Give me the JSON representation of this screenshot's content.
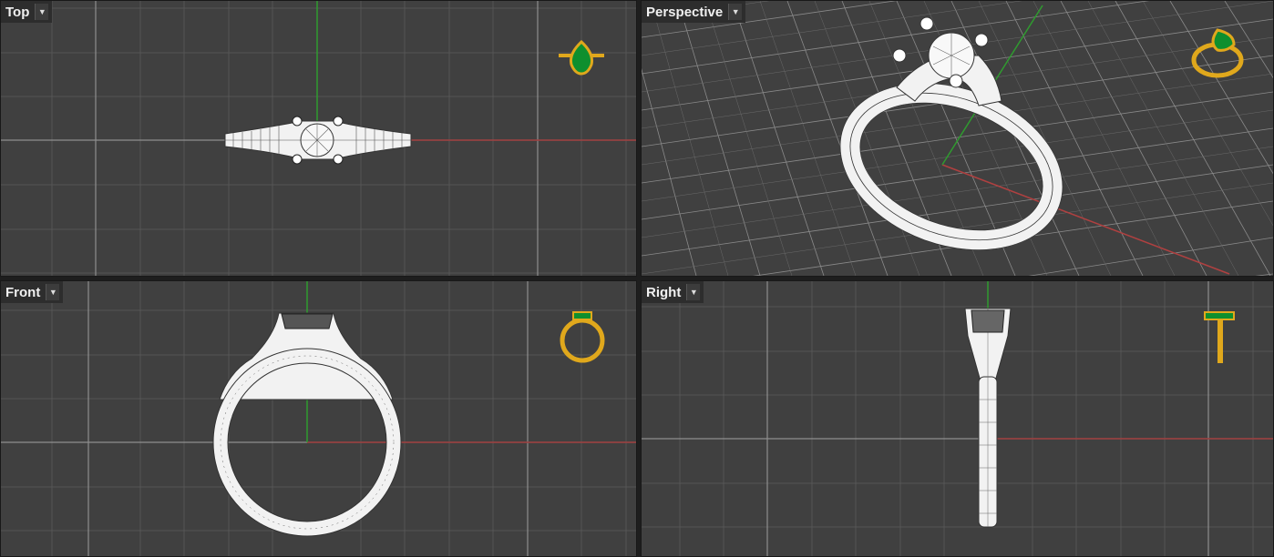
{
  "viewports": {
    "top": {
      "label": "Top",
      "menu_icon": "chevron-down-icon"
    },
    "perspective": {
      "label": "Perspective",
      "menu_icon": "chevron-down-icon"
    },
    "front": {
      "label": "Front",
      "menu_icon": "chevron-down-icon"
    },
    "right": {
      "label": "Right",
      "menu_icon": "chevron-down-icon"
    }
  },
  "colors": {
    "viewport_bg": "#404040",
    "grid_minor": "#4e4e4e",
    "grid_major": "#8a8a8a",
    "x_axis": "#9b3b3b",
    "y_axis": "#2f9b2f",
    "wireframe": "#f2f2f2",
    "wire_lines": "#3a3a3a",
    "gold": "#e0a81c",
    "gem": "#0e8f2e"
  },
  "icons": {
    "preview_thumbnail": "ring-preview-icon",
    "model": "ring-wireframe"
  }
}
